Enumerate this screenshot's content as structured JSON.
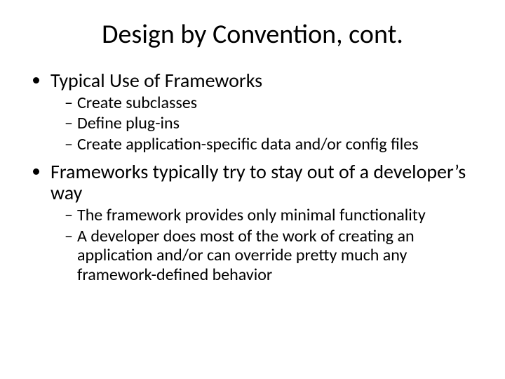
{
  "title": "Design by Convention, cont.",
  "b1": {
    "text": "Typical Use of Frameworks",
    "sub": {
      "s1": "Create subclasses",
      "s2": "Define plug-ins",
      "s3": "Create application-specific data and/or config files"
    }
  },
  "b2": {
    "text": "Frameworks typically try to stay out of a developer’s way",
    "sub": {
      "s1": "The framework provides only minimal functionality",
      "s2": "A developer does most of the work of creating an application and/or can override pretty much any framework-defined behavior"
    }
  }
}
